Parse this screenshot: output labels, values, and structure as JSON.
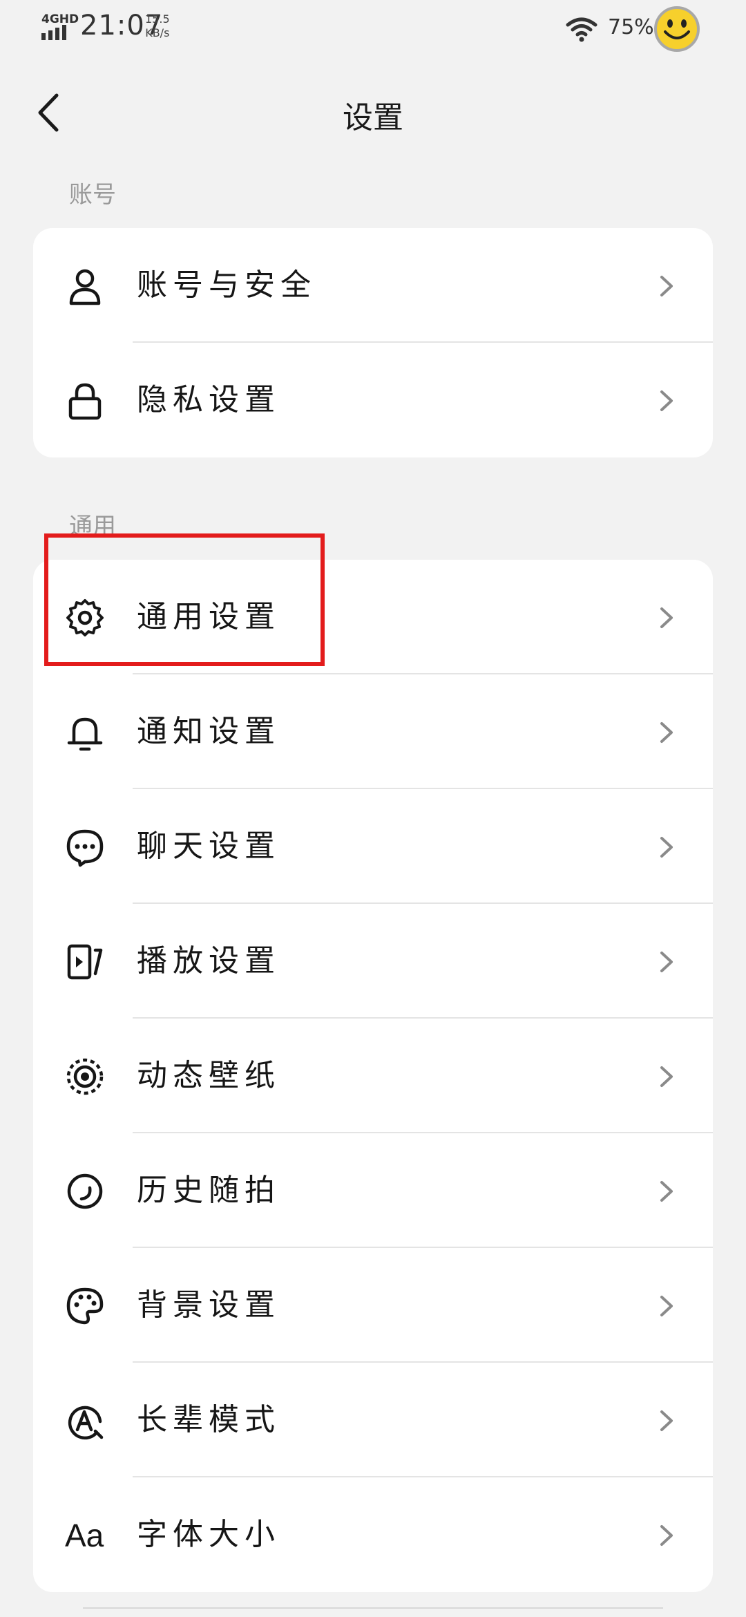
{
  "status_bar": {
    "network": "4GHD",
    "time": "21:07",
    "speed_value": "15.5",
    "speed_unit": "KB/s",
    "battery": "75%"
  },
  "header": {
    "title": "设置"
  },
  "sections": [
    {
      "label": "账号",
      "items": [
        {
          "label": "账号与安全",
          "icon": "user-icon"
        },
        {
          "label": "隐私设置",
          "icon": "lock-icon"
        }
      ]
    },
    {
      "label": "通用",
      "items": [
        {
          "label": "通用设置",
          "icon": "gear-icon"
        },
        {
          "label": "通知设置",
          "icon": "bell-icon"
        },
        {
          "label": "聊天设置",
          "icon": "chat-bubble-icon"
        },
        {
          "label": "播放设置",
          "icon": "play-video-icon"
        },
        {
          "label": "动态壁纸",
          "icon": "live-wallpaper-icon"
        },
        {
          "label": "历史随拍",
          "icon": "history-circle-icon"
        },
        {
          "label": "背景设置",
          "icon": "palette-icon"
        },
        {
          "label": "长辈模式",
          "icon": "elder-mode-icon"
        },
        {
          "label": "字体大小",
          "icon": "font-size-icon",
          "icon_text": "Aa"
        }
      ]
    }
  ],
  "colors": {
    "background": "#f2f2f2",
    "card": "#ffffff",
    "highlight": "#e31c1c",
    "text": "#161616",
    "section_label": "#9a9a9a"
  }
}
